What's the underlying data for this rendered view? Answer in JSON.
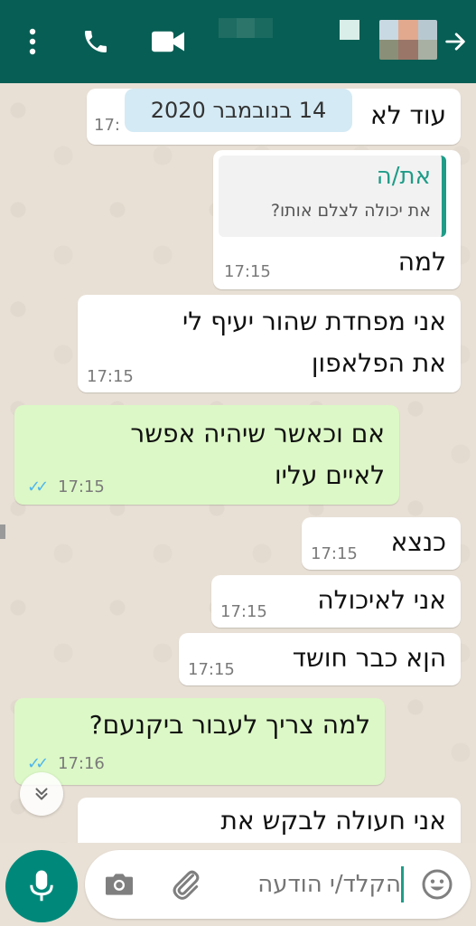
{
  "header": {
    "menu_icon": "more-vert-icon",
    "call_icon": "phone-icon",
    "video_icon": "videocam-icon",
    "back_icon": "arrow-back-icon",
    "background_color": "#075e54"
  },
  "chat": {
    "date_chip": "14 בנובמבר 2020",
    "messages": [
      {
        "dir": "in",
        "text": "עוד לא",
        "time": "17:"
      },
      {
        "dir": "in",
        "reply_sender": "את/ה",
        "reply_text": "את יכולה לצלם אותו?",
        "text": "למה",
        "time": "17:15"
      },
      {
        "dir": "in",
        "line1": "אני מפחדת שהור יעיף לי",
        "line2": "את הפלאפון",
        "time": "17:15"
      },
      {
        "dir": "out",
        "line1": "אם וכאשר שיהיה אפשר",
        "line2": "לאיים עליו",
        "time": "17:15",
        "ticks": "✓✓"
      },
      {
        "dir": "in",
        "text": "כנצא",
        "time": "17:15"
      },
      {
        "dir": "in",
        "text": "אני לאיכולה",
        "time": "17:15"
      },
      {
        "dir": "in",
        "text": "הןא כבר חושד",
        "time": "17:15"
      },
      {
        "dir": "out",
        "text": "למה צריך לעבור ביקנעם?",
        "time": "17:16",
        "ticks": "✓✓"
      },
      {
        "dir": "in",
        "text": "אני חעולה לבקש את",
        "time": ""
      }
    ],
    "incoming_color": "#ffffff",
    "outgoing_color": "#dcf8c6",
    "scroll_icon": "double-chevron-down-icon"
  },
  "input": {
    "placeholder": "הקלד/י הודעה",
    "camera_icon": "camera-icon",
    "attach_icon": "paperclip-icon",
    "emoji_icon": "emoji-icon",
    "mic_icon": "mic-icon",
    "accent_color": "#00897b"
  }
}
